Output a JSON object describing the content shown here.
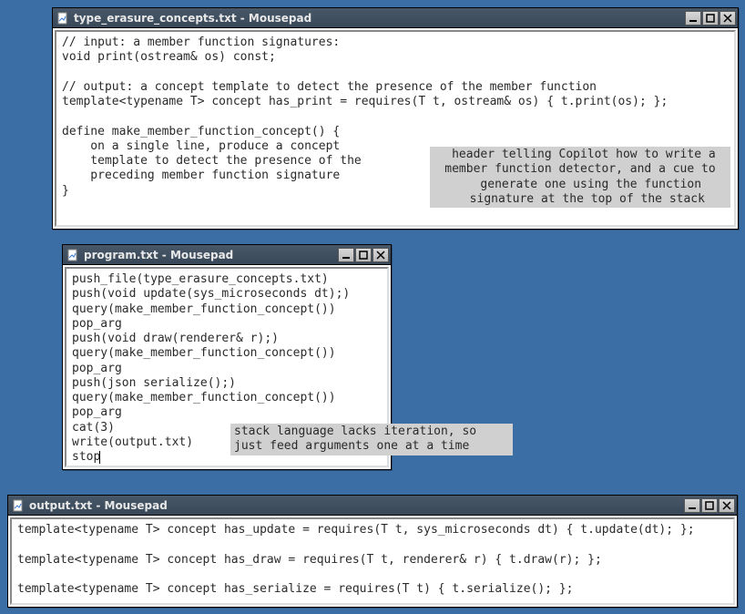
{
  "windows": {
    "concepts": {
      "title": "type_erasure_concepts.txt - Mousepad",
      "content": "// input: a member function signatures:\nvoid print(ostream& os) const;\n\n// output: a concept template to detect the presence of the member function\ntemplate<typename T> concept has_print = requires(T t, ostream& os) { t.print(os); };\n\ndefine make_member_function_concept() {\n    on a single line, produce a concept\n    template to detect the presence of the\n    preceding member function signature\n}",
      "annotation": " header telling Copilot how to write a\nmember function detector, and a cue to\n   generate one using the function\n  signature at the top of the stack"
    },
    "program": {
      "title": "program.txt - Mousepad",
      "content": "push_file(type_erasure_concepts.txt)\npush(void update(sys_microseconds dt);)\nquery(make_member_function_concept())\npop_arg\npush(void draw(renderer& r);)\nquery(make_member_function_concept())\npop_arg\npush(json serialize();)\nquery(make_member_function_concept())\npop_arg\ncat(3)\nwrite(output.txt)\nstop",
      "annotation": "stack language lacks iteration, so\njust feed arguments one at a time"
    },
    "output": {
      "title": "output.txt - Mousepad",
      "content": "template<typename T> concept has_update = requires(T t, sys_microseconds dt) { t.update(dt); };\n\ntemplate<typename T> concept has_draw = requires(T t, renderer& r) { t.draw(r); };\n\ntemplate<typename T> concept has_serialize = requires(T t) { t.serialize(); };"
    }
  }
}
